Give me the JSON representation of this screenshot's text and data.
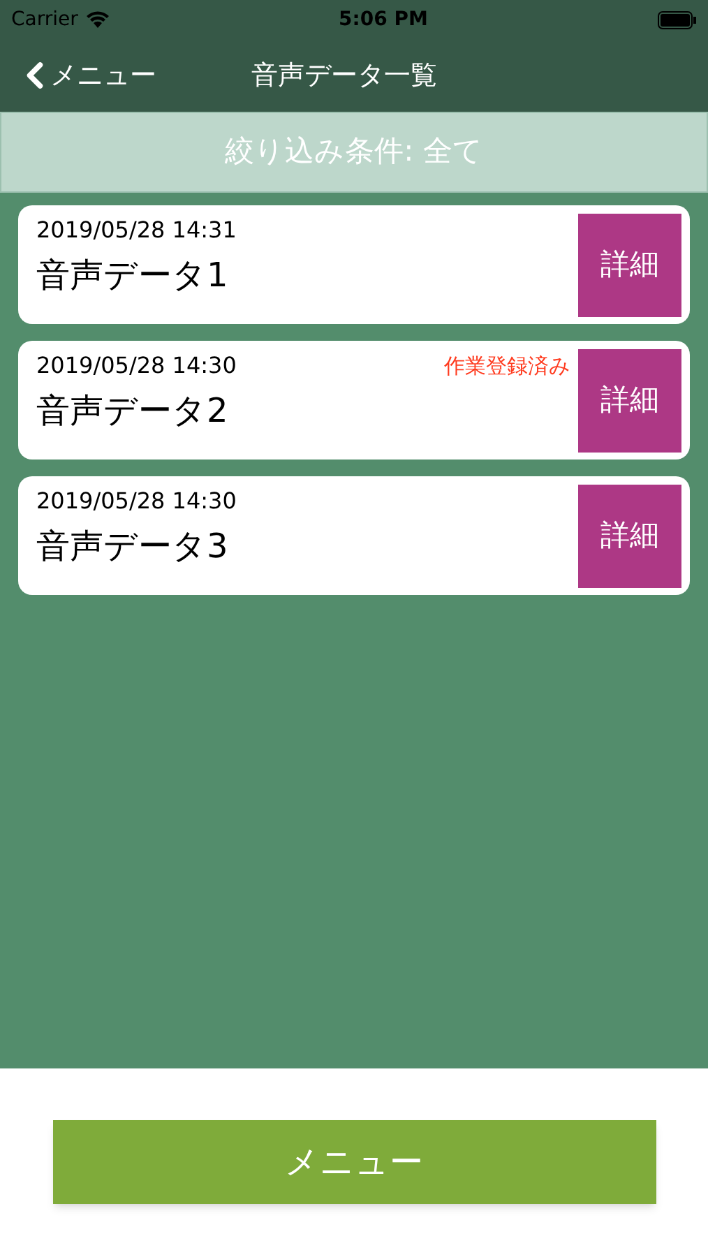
{
  "status_bar": {
    "carrier": "Carrier",
    "time": "5:06 PM"
  },
  "nav": {
    "back_label": "メニュー",
    "title": "音声データ一覧"
  },
  "filter": {
    "label": "絞り込み条件: 全て"
  },
  "items": [
    {
      "date": "2019/05/28 14:31",
      "name": "音声データ1",
      "detail_label": "詳細"
    },
    {
      "date": "2019/05/28 14:30",
      "name": "音声データ2",
      "badge": "作業登録済み",
      "detail_label": "詳細"
    },
    {
      "date": "2019/05/28 14:30",
      "name": "音声データ3",
      "detail_label": "詳細"
    }
  ],
  "menu_button": {
    "label": "メニュー"
  }
}
